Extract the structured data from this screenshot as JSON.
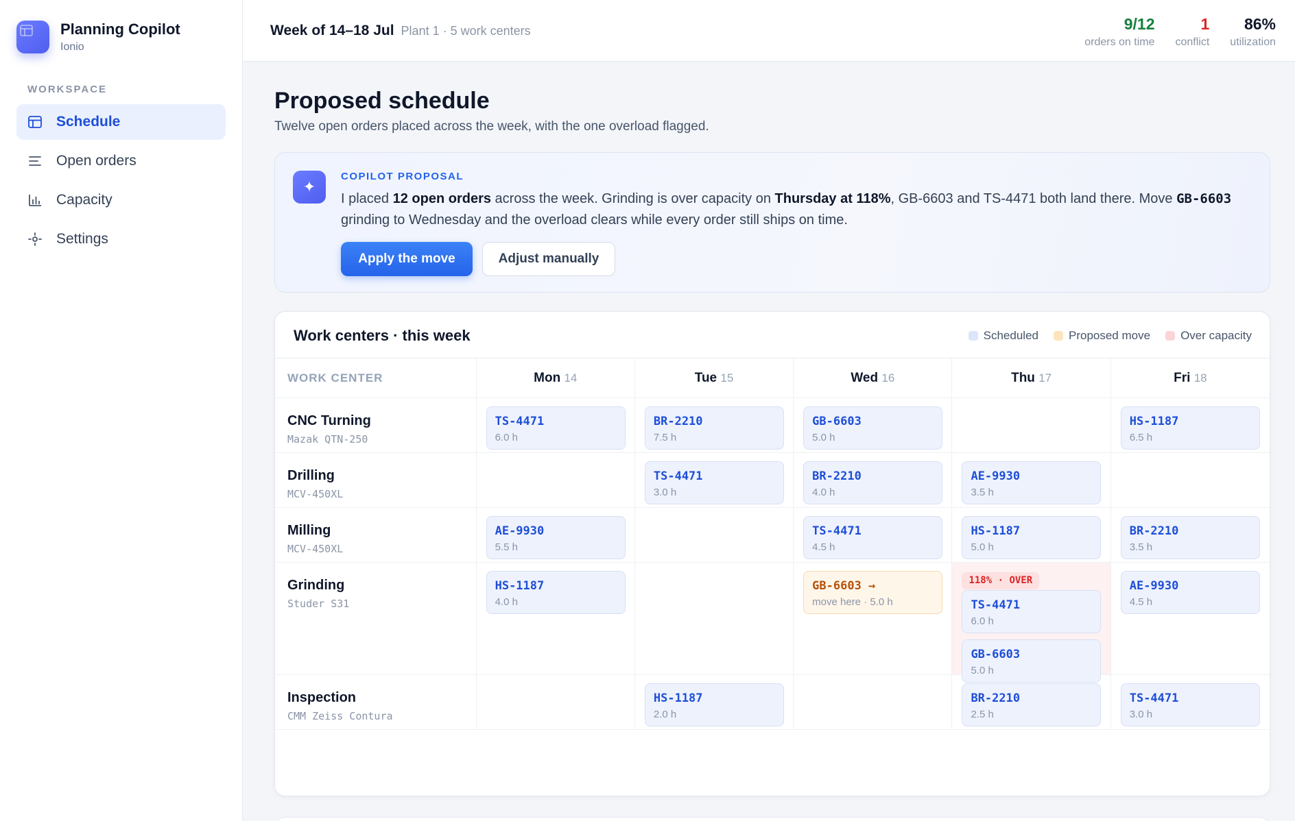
{
  "app": {
    "title": "Planning Copilot",
    "org": "Ionio"
  },
  "sidebar": {
    "section_label": "WORKSPACE",
    "items": [
      {
        "label": "Schedule",
        "icon": "calendar-grid-icon",
        "active": true
      },
      {
        "label": "Open orders",
        "icon": "list-icon",
        "active": false
      },
      {
        "label": "Capacity",
        "icon": "bar-chart-icon",
        "active": false
      },
      {
        "label": "Settings",
        "icon": "gear-icon",
        "active": false
      }
    ]
  },
  "header": {
    "week": "Week of 14–18 Jul",
    "week_sub": "Plant 1 · 5 work centers",
    "stats": [
      {
        "value": "9/12",
        "label": "orders on time",
        "color": "#15803d"
      },
      {
        "value": "1",
        "label": "conflict",
        "color": "#dc2626"
      },
      {
        "value": "86%",
        "label": "utilization",
        "color": "#0f172a"
      }
    ]
  },
  "main": {
    "title": "Proposed schedule",
    "subtitle": "Twelve open orders placed across the week, with the one overload flagged."
  },
  "proposal": {
    "label": "COPILOT PROPOSAL",
    "text_1": "I placed ",
    "text_bold_1": "12 open orders",
    "text_2": " across the week. Grinding is over capacity on ",
    "text_bold_2": "Thursday at 118%",
    "text_3": ", GB-6603 and TS-4471 both land there. Move ",
    "text_code": "GB-6603",
    "text_4": " grinding to Wednesday and the overload clears while every order still ships on time.",
    "apply_label": "Apply the move",
    "adjust_label": "Adjust manually"
  },
  "schedule": {
    "title": "Work centers · this week",
    "legend": [
      {
        "label": "Scheduled",
        "color": "#dbe5fb"
      },
      {
        "label": "Proposed move",
        "color": "#fde4bd"
      },
      {
        "label": "Over capacity",
        "color": "#fbd5d5"
      }
    ],
    "col_header": "WORK CENTER",
    "days": [
      {
        "day": "Mon",
        "num": "14"
      },
      {
        "day": "Tue",
        "num": "15"
      },
      {
        "day": "Wed",
        "num": "16"
      },
      {
        "day": "Thu",
        "num": "17"
      },
      {
        "day": "Fri",
        "num": "18"
      }
    ],
    "rows": [
      {
        "name": "CNC Turning",
        "machine": "Mazak QTN-250",
        "cells": [
          {
            "jobs": [
              {
                "id": "TS-4471",
                "hours": "6.0 h"
              }
            ]
          },
          {
            "jobs": [
              {
                "id": "BR-2210",
                "hours": "7.5 h"
              }
            ]
          },
          {
            "jobs": [
              {
                "id": "GB-6603",
                "hours": "5.0 h"
              }
            ]
          },
          {
            "jobs": []
          },
          {
            "jobs": [
              {
                "id": "HS-1187",
                "hours": "6.5 h"
              }
            ]
          }
        ]
      },
      {
        "name": "Drilling",
        "machine": "MCV-450XL",
        "cells": [
          {
            "jobs": []
          },
          {
            "jobs": [
              {
                "id": "TS-4471",
                "hours": "3.0 h"
              }
            ]
          },
          {
            "jobs": [
              {
                "id": "BR-2210",
                "hours": "4.0 h"
              }
            ]
          },
          {
            "jobs": [
              {
                "id": "AE-9930",
                "hours": "3.5 h"
              }
            ]
          },
          {
            "jobs": []
          }
        ]
      },
      {
        "name": "Milling",
        "machine": "MCV-450XL",
        "cells": [
          {
            "jobs": [
              {
                "id": "AE-9930",
                "hours": "5.5 h"
              }
            ]
          },
          {
            "jobs": []
          },
          {
            "jobs": [
              {
                "id": "TS-4471",
                "hours": "4.5 h"
              }
            ]
          },
          {
            "jobs": [
              {
                "id": "HS-1187",
                "hours": "5.0 h"
              }
            ]
          },
          {
            "jobs": [
              {
                "id": "BR-2210",
                "hours": "3.5 h"
              }
            ]
          }
        ]
      },
      {
        "name": "Grinding",
        "machine": "Studer S31",
        "cells": [
          {
            "jobs": [
              {
                "id": "HS-1187",
                "hours": "4.0 h"
              }
            ]
          },
          {
            "jobs": []
          },
          {
            "jobs": [
              {
                "id": "GB-6603 →",
                "hours": "move here · 5.0 h",
                "proposed": true
              }
            ]
          },
          {
            "over": "118% · OVER",
            "jobs": [
              {
                "id": "TS-4471",
                "hours": "6.0 h"
              },
              {
                "id": "GB-6603",
                "hours": "5.0 h"
              }
            ]
          },
          {
            "jobs": [
              {
                "id": "AE-9930",
                "hours": "4.5 h"
              }
            ]
          }
        ]
      },
      {
        "name": "Inspection",
        "machine": "CMM Zeiss Contura",
        "cells": [
          {
            "jobs": []
          },
          {
            "jobs": [
              {
                "id": "HS-1187",
                "hours": "2.0 h"
              }
            ]
          },
          {
            "jobs": []
          },
          {
            "jobs": [
              {
                "id": "BR-2210",
                "hours": "2.5 h"
              }
            ]
          },
          {
            "jobs": [
              {
                "id": "TS-4471",
                "hours": "3.0 h"
              }
            ]
          }
        ]
      }
    ]
  }
}
